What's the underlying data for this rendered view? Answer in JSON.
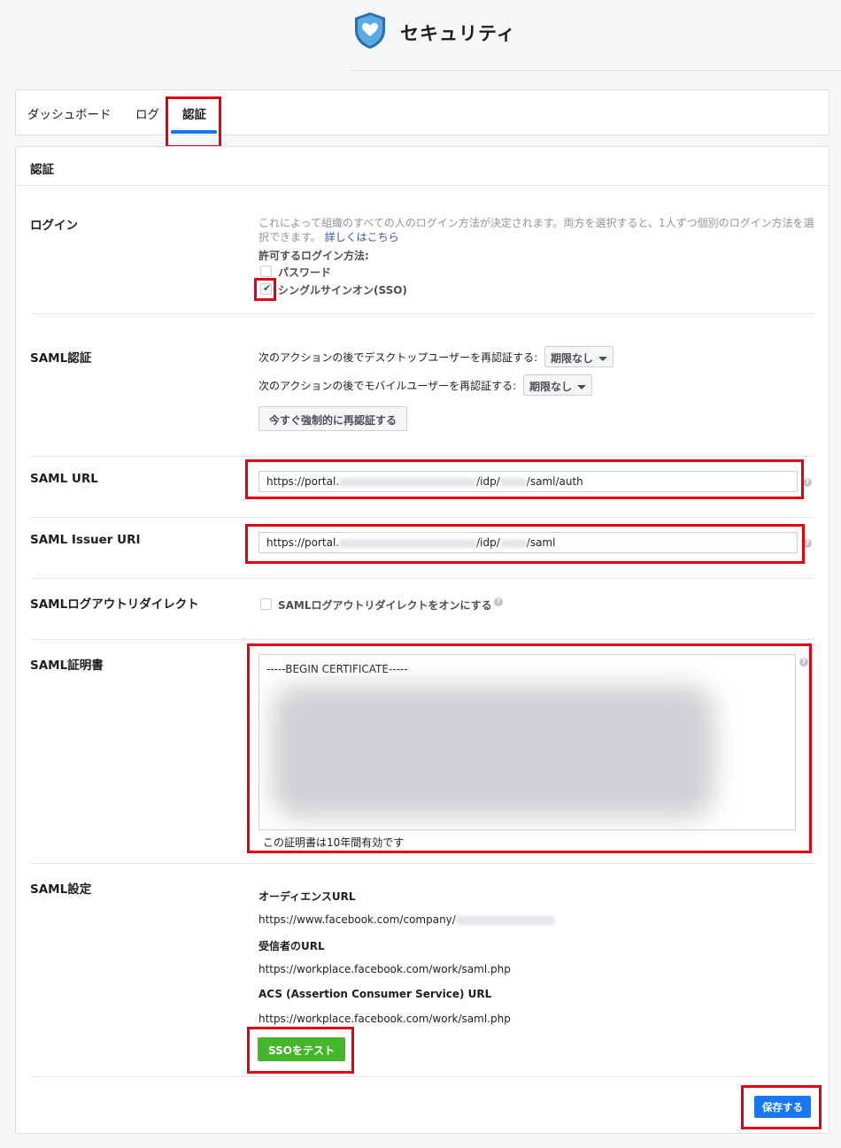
{
  "header": {
    "title": "セキュリティ",
    "logo_icon": "shield-heart-icon",
    "logo_color": "#4a9fe0"
  },
  "tabs": [
    {
      "label": "ダッシュボード",
      "active": false
    },
    {
      "label": "ログ",
      "active": false
    },
    {
      "label": "認証",
      "active": true
    }
  ],
  "section_title": "認証",
  "login": {
    "label": "ログイン",
    "description_1": "これによって組織のすべての人のログイン方法が決定されます。両方を選択すると、1人ずつ個別のログイン方法を選",
    "description_2": "択できます。",
    "learn_more": "詳しくはこちら",
    "allowed_label": "許可するログイン方法:",
    "options": [
      {
        "label": "パスワード",
        "checked": false
      },
      {
        "label": "シングルサインオン(SSO)",
        "checked": true
      }
    ]
  },
  "saml_auth": {
    "label": "SAML認証",
    "desktop_prompt": "次のアクションの後でデスクトップユーザーを再認証する:",
    "desktop_value": "期限なし",
    "mobile_prompt": "次のアクションの後でモバイルユーザーを再認証する:",
    "mobile_value": "期限なし",
    "force_button": "今すぐ強制的に再認証する"
  },
  "saml_url": {
    "label": "SAML URL",
    "value_start": "https://portal.",
    "value_mid": "/idp/",
    "value_end": "/saml/auth"
  },
  "saml_issuer": {
    "label": "SAML Issuer URI",
    "value_start": "https://portal.",
    "value_mid": "/idp/",
    "value_end": "/saml"
  },
  "saml_logout": {
    "label": "SAMLログアウトリダイレクト",
    "checkbox_label": "SAMLログアウトリダイレクトをオンにする",
    "checked": false
  },
  "saml_cert": {
    "label": "SAML証明書",
    "header": "-----BEGIN CERTIFICATE-----",
    "validity": "この証明書は10年間有効です"
  },
  "saml_settings": {
    "label": "SAML設定",
    "audience_label": "オーディエンスURL",
    "audience_value": "https://www.facebook.com/company/",
    "recipient_label": "受信者のURL",
    "recipient_value": "https://workplace.facebook.com/work/saml.php",
    "acs_label": "ACS (Assertion Consumer Service) URL",
    "acs_value": "https://workplace.facebook.com/work/saml.php",
    "test_button": "SSOをテスト"
  },
  "save_button": "保存する",
  "colors": {
    "primary": "#1877f2",
    "success": "#42b72a",
    "highlight": "#e60012"
  }
}
